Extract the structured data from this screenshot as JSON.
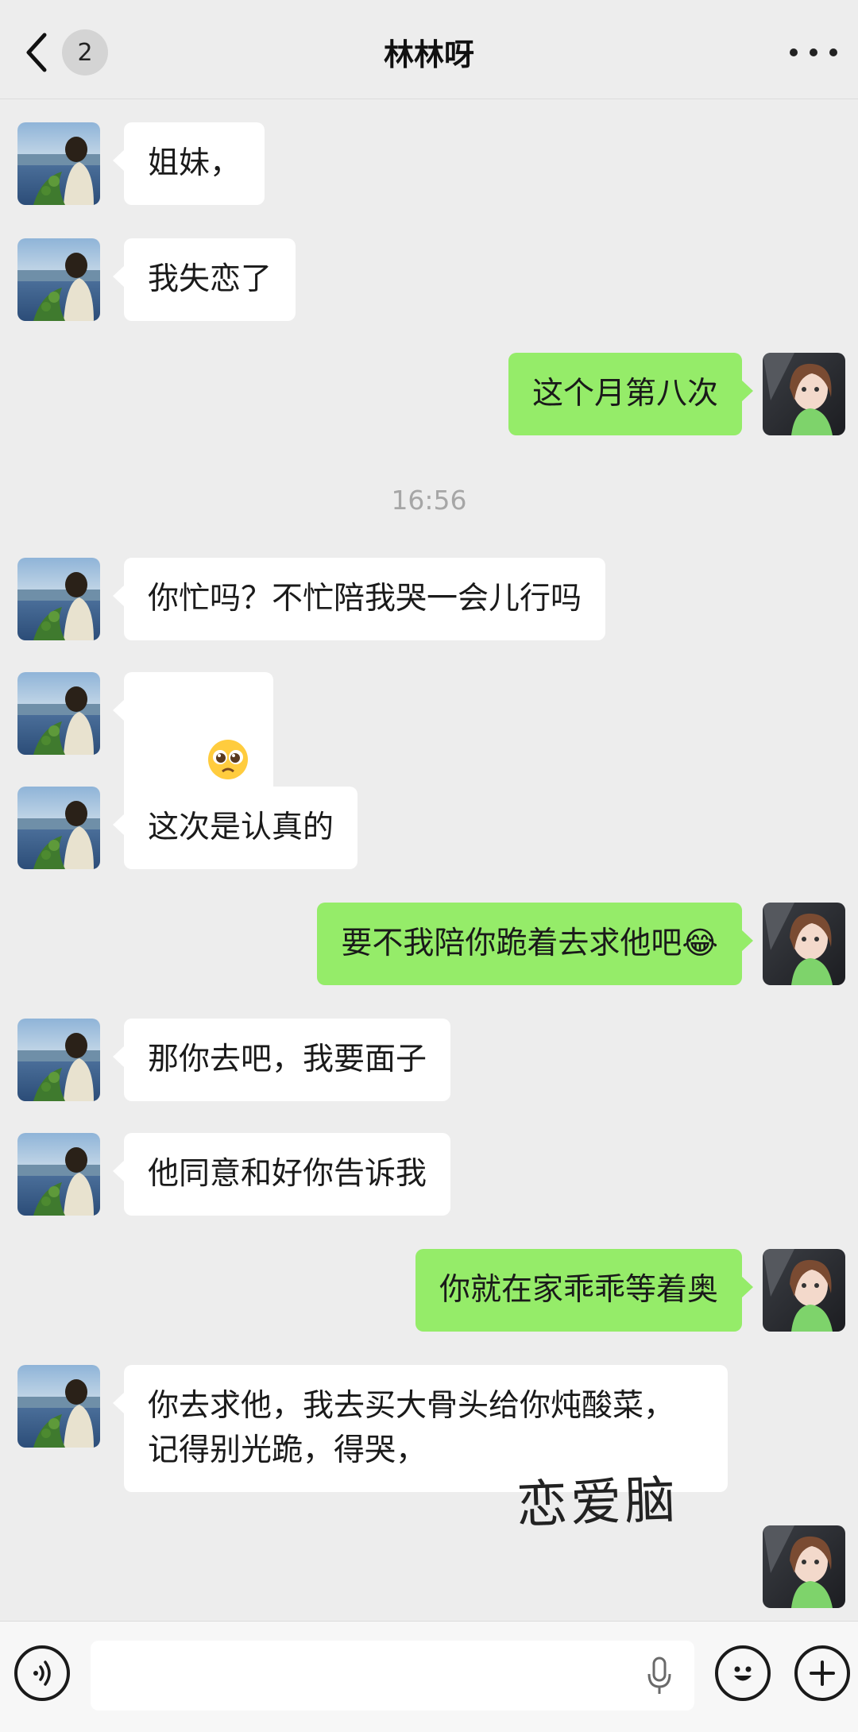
{
  "header": {
    "unread_count": "2",
    "title": "林林呀"
  },
  "timestamp": "16:56",
  "messages": [
    {
      "dir": "in",
      "text": "姐妹，"
    },
    {
      "dir": "in",
      "text": "我失恋了"
    },
    {
      "dir": "out",
      "text": "这个月第八次"
    },
    {
      "dir": "in",
      "text": "你忙吗？不忙陪我哭一会儿行吗"
    },
    {
      "dir": "in",
      "text": "🥺"
    },
    {
      "dir": "in",
      "text": "这次是认真的"
    },
    {
      "dir": "out",
      "text": "要不我陪你跪着去求他吧😂"
    },
    {
      "dir": "in",
      "text": "那你去吧，我要面子"
    },
    {
      "dir": "in",
      "text": "他同意和好你告诉我"
    },
    {
      "dir": "out",
      "text": "你就在家乖乖等着奥"
    },
    {
      "dir": "in",
      "text": "你去求他，我去买大骨头给你炖酸菜，\n记得别光跪，得哭，"
    }
  ],
  "watermark": "恋爱脑",
  "colors": {
    "background": "#ededed",
    "incoming_bubble": "#ffffff",
    "outgoing_bubble": "#95ec69",
    "timestamp": "#a6a6a6"
  },
  "icons": {
    "back": "chevron-left-icon",
    "more": "more-dots-icon",
    "voice": "voice-icon",
    "mic": "mic-icon",
    "emoji": "emoji-icon",
    "plus": "plus-icon"
  }
}
